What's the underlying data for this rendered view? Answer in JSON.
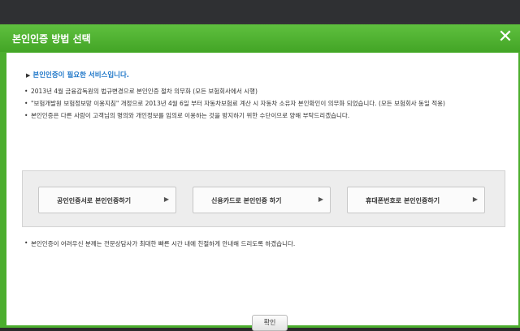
{
  "modal": {
    "title": "본인인증 방법 선택",
    "close_label": "✕"
  },
  "notice": {
    "heading": "본인인증이 필요한 서비스입니다.",
    "items": [
      "2013년 4월 금융감독원의 법규변경으로 본인인증 절차 의무화 (모든 보험회사에서 시행)",
      "\"보험개발원 보험정보망 이용지침\" 개정으로 2013년 4월 6일 부터 자동차보험료 계산 시 자동차 소유자 본인확인이 의무화 되었습니다. (모든 보험회사 동일 적용)",
      "본인인증은 다른 사람이 고객님의 명의와 개인정보를 임의로 이용하는 것을 방지하기 위한 수단이므로 양해 부탁드리겠습니다."
    ]
  },
  "choices": [
    {
      "label": "공인인증서로 본인인증하기"
    },
    {
      "label": "신용카드로 본인인증 하기"
    },
    {
      "label": "휴대폰번호로 본인인증하기"
    }
  ],
  "bottom_note": "본인인증이 어려우신 분께는 전문상담사가 최대한 빠른 시간 내에 친절하게 안내해 드리도록 하겠습니다.",
  "confirm_label": "확인",
  "icons": {
    "heading_marker": "triangle-right",
    "choice_arrow": "triangle-right"
  }
}
